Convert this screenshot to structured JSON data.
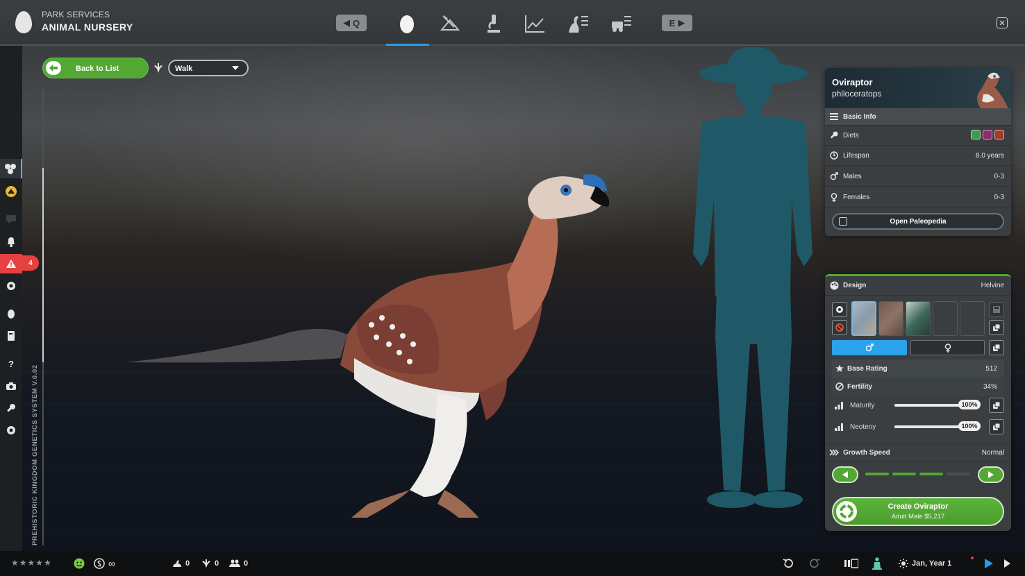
{
  "header": {
    "supertitle": "PARK SERVICES",
    "title": "ANIMAL NURSERY",
    "prev_key": "Q",
    "next_key": "E",
    "tabs": [
      {
        "name": "egg-icon",
        "active": true
      },
      {
        "name": "dig-site-icon",
        "active": false
      },
      {
        "name": "microscope-icon",
        "active": false
      },
      {
        "name": "chart-line-icon",
        "active": false
      },
      {
        "name": "dino-list-icon",
        "active": false
      },
      {
        "name": "vehicle-list-icon",
        "active": false
      }
    ],
    "accent": "#2a9ce6"
  },
  "toolbar": {
    "back_label": "Back to List",
    "animation_selected": "Walk"
  },
  "left_rail": {
    "alert_count": "4",
    "version_text": "PREHISTORIC KINGDOM GENETICS SYSTEM V.0.02"
  },
  "info_panel": {
    "name": "Oviraptor",
    "variant": "philoceratops",
    "section_label": "Basic Info",
    "rows": [
      {
        "icon": "drumstick-icon",
        "label": "Diets",
        "value": ""
      },
      {
        "icon": "clock-icon",
        "label": "Lifespan",
        "value": "8.0 years"
      },
      {
        "icon": "male-icon",
        "label": "Males",
        "value": "0-3"
      },
      {
        "icon": "female-icon",
        "label": "Females",
        "value": "0-3"
      }
    ],
    "diet_colors": [
      "#3f9a4e",
      "#8a2e6a",
      "#a33a2a"
    ],
    "paleopedia_label": "Open Paleopedia"
  },
  "design_panel": {
    "label": "Design",
    "design_name": "Helvine",
    "base_rating_label": "Base Rating",
    "base_rating_value": "512",
    "fertility_label": "Fertility",
    "fertility_value": "34%",
    "maturity_label": "Maturity",
    "maturity_value": "100%",
    "neoteny_label": "Neoteny",
    "neoteny_value": "100%",
    "growth_label": "Growth Speed",
    "growth_value": "Normal",
    "growth_level": 3,
    "growth_max": 4,
    "create_title": "Create Oviraptor",
    "create_sub": "Adult Male $5,217",
    "accent": "#52a832"
  },
  "bottom_bar": {
    "rating_stars": 5,
    "currency_value": "∞",
    "stat_animals": "0",
    "stat_guests": "0",
    "stat_staff": "0",
    "date": "Jan, Year 1"
  }
}
